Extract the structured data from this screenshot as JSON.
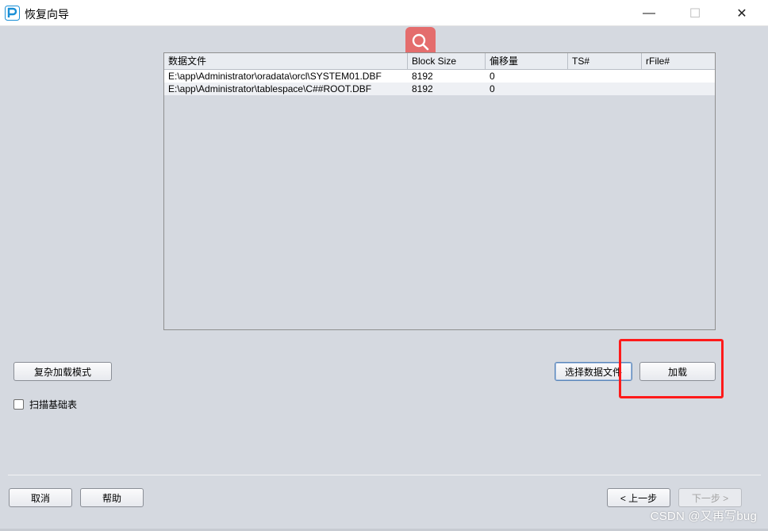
{
  "window": {
    "title": "恢复向导",
    "min_glyph": "—",
    "max_glyph": "☐",
    "close_glyph": "✕"
  },
  "table": {
    "columns": [
      "数据文件",
      "Block Size",
      "偏移量",
      "TS#",
      "rFile#"
    ],
    "rows": [
      [
        "E:\\app\\Administrator\\oradata\\orcl\\SYSTEM01.DBF",
        "8192",
        "0",
        "",
        ""
      ],
      [
        "E:\\app\\Administrator\\tablespace\\C##ROOT.DBF",
        "8192",
        "0",
        "",
        ""
      ]
    ]
  },
  "buttons": {
    "complex_load_mode": "复杂加载模式",
    "select_datafile": "选择数据文件",
    "load": "加载",
    "cancel": "取消",
    "help": "帮助",
    "prev": "< 上一步",
    "next": "下一步 >"
  },
  "checkbox": {
    "scan_base_tables": "扫描基础表",
    "checked": false
  },
  "watermark": "CSDN @又再写bug",
  "colors": {
    "background": "#d5d9e0",
    "highlight": "#ff1a1a",
    "search_fab": "#e46d6d",
    "app_icon": "#1a8fd6"
  },
  "icons": [
    "app-logo-icon",
    "search-icon",
    "minimize-icon",
    "maximize-icon",
    "close-icon"
  ]
}
